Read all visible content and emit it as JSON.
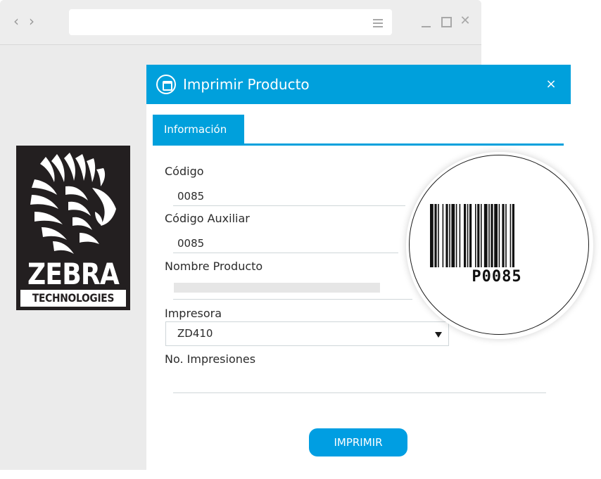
{
  "browser": {
    "back_icon": "chevron-left-icon",
    "forward_icon": "chevron-right-icon",
    "url": "",
    "menu_icon": "hamburger-icon",
    "controls": [
      "minimize-icon",
      "maximize-icon",
      "close-icon"
    ]
  },
  "logo": {
    "name": "Zebra Technologies",
    "word1": "ZEBRA",
    "word2": "TECHNOLOGIES"
  },
  "dialog": {
    "title": "Imprimir Producto",
    "close_label": "×",
    "tabs": [
      {
        "label": "Información"
      }
    ],
    "fields": {
      "codigo": {
        "label": "Código",
        "value": "0085"
      },
      "codigo_auxiliar": {
        "label": "Código Auxiliar",
        "value": "0085"
      },
      "nombre_producto": {
        "label": "Nombre Producto",
        "value": ""
      },
      "impresora": {
        "label": "Impresora",
        "value": "ZD410"
      },
      "no_impresiones": {
        "label": "No. Impresiones",
        "value": ""
      }
    },
    "print_button": "IMPRIMIR"
  },
  "barcode": {
    "text": "P0085"
  },
  "colors": {
    "accent": "#00a0dc",
    "browser_bg": "#ebebeb",
    "logo_bg": "#231f20"
  }
}
